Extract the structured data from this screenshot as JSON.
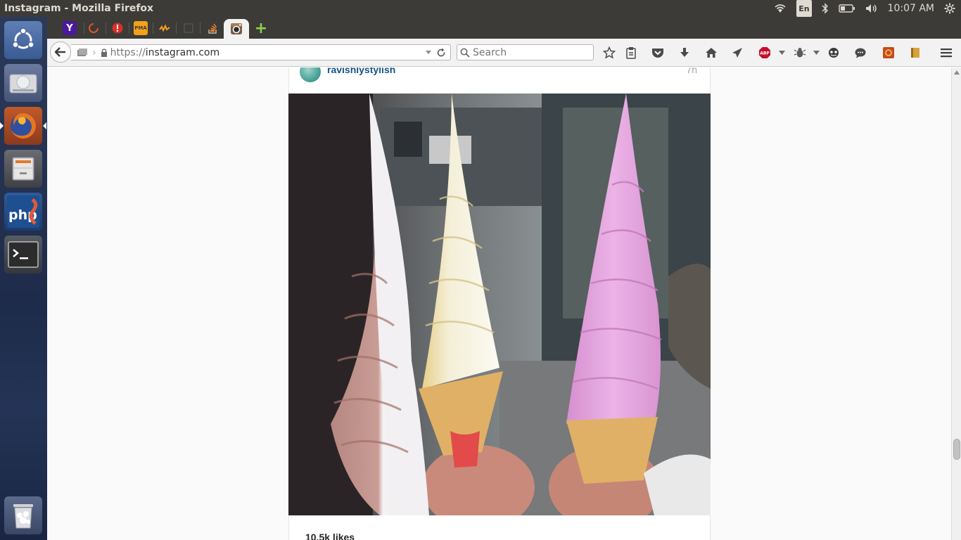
{
  "topPanel": {
    "windowTitle": "Instagram - Mozilla Firefox",
    "keyboardLayout": "En",
    "clock": "10:07 AM"
  },
  "launcher": {
    "items": [
      "ubuntu-dash",
      "disks",
      "firefox",
      "files",
      "phpstorm",
      "terminal",
      "trash"
    ],
    "phpLabel": "php"
  },
  "tabs": {
    "pinned": [
      "yahoo",
      "opera",
      "alert",
      "pma",
      "wave",
      "blank",
      "stackoverflow",
      "instagram"
    ],
    "yahooGlyph": "Y",
    "pmaGlyph": "PMA",
    "newTabGlyph": "+"
  },
  "navbar": {
    "urlProtocol": "https://",
    "urlHost": "instagram.com",
    "searchPlaceholder": "Search",
    "abpLabel": "ABP"
  },
  "post": {
    "username": "ravishlystylish",
    "timeAgo": "7h",
    "likes": "10.5k likes"
  },
  "colors": {
    "usernameBlue": "#125688",
    "panelBg": "#3c3b37",
    "cone": "#e0b066"
  }
}
